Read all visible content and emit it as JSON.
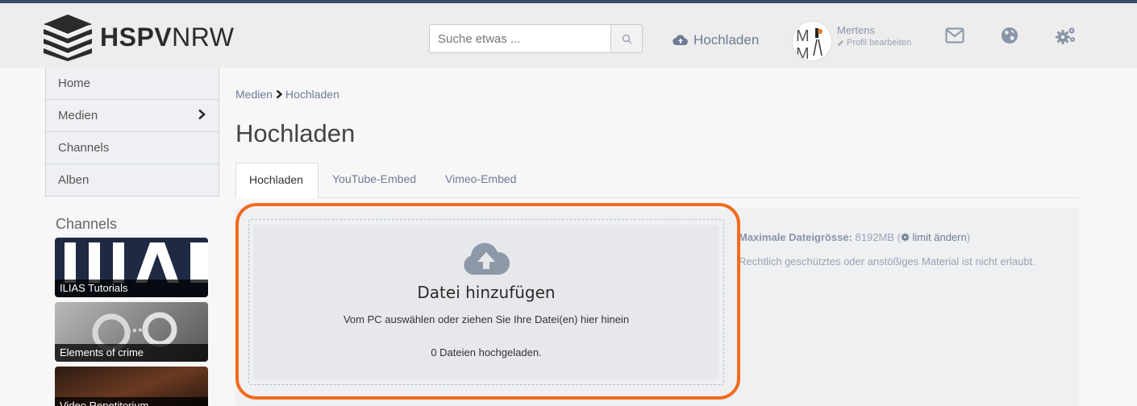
{
  "header": {
    "logo_bold": "HSPV",
    "logo_light": "NRW",
    "search_placeholder": "Suche etwas ...",
    "upload_label": "Hochladen",
    "user_name": "Mertens",
    "profile_edit_label": "Profil bearbeiten"
  },
  "sidebar": {
    "items": [
      {
        "label": "Home"
      },
      {
        "label": "Medien"
      },
      {
        "label": "Channels"
      },
      {
        "label": "Alben"
      }
    ],
    "channels_title": "Channels",
    "channels": [
      {
        "label": "ILIAS Tutorials"
      },
      {
        "label": "Elements of crime"
      },
      {
        "label": "Video Repetitorium"
      }
    ]
  },
  "main": {
    "breadcrumb": [
      "Medien",
      "Hochladen"
    ],
    "title": "Hochladen",
    "tabs": [
      {
        "label": "Hochladen"
      },
      {
        "label": "YouTube-Embed"
      },
      {
        "label": "Vimeo-Embed"
      }
    ],
    "dropzone": {
      "title": "Datei hinzufügen",
      "subtitle": "Vom PC auswählen oder ziehen Sie Ihre Datei(en) hier hinein",
      "count": "0 Dateien hochgeladen."
    },
    "info": {
      "max_label": "Maximale Dateigrösse:",
      "max_value": "8192MB",
      "limit_link": "limit ändern",
      "notice": "Rechtlich geschütztes oder anstößiges Material ist nicht erlaubt."
    }
  },
  "colors": {
    "highlight": "#f26b1d",
    "accent": "#3e4a6d",
    "link": "#6e7b94"
  }
}
